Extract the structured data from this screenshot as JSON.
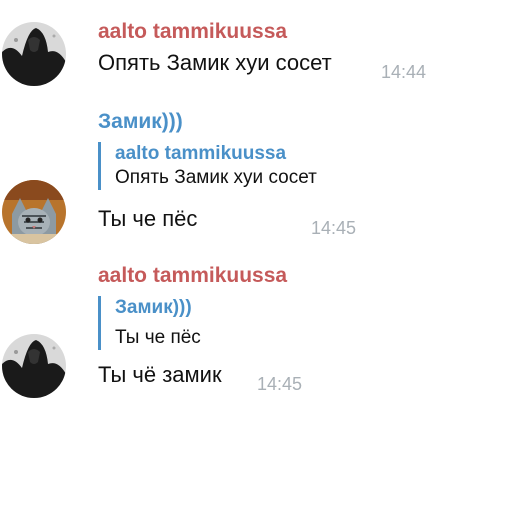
{
  "messages": [
    {
      "sender": "aalto tammikuussa",
      "text": "Опять Замик хуи сосет",
      "time": "14:44",
      "avatar": "dark-figure-avatar"
    },
    {
      "sender": "Замик)))",
      "reply": {
        "name": "aalto tammikuussa",
        "text": "Опять Замик хуи сосет"
      },
      "text": "Ты че пёс",
      "time": "14:45",
      "avatar": "cat-avatar"
    },
    {
      "sender": "aalto tammikuussa",
      "reply": {
        "name": "Замик)))",
        "text": "Ты че пёс"
      },
      "text": "Ты чё замик",
      "time": "14:45",
      "avatar": "dark-figure-avatar"
    }
  ],
  "colors": {
    "sender_red": "#c55a5a",
    "sender_blue": "#4a90c8",
    "time_gray": "#a9b0b6"
  }
}
